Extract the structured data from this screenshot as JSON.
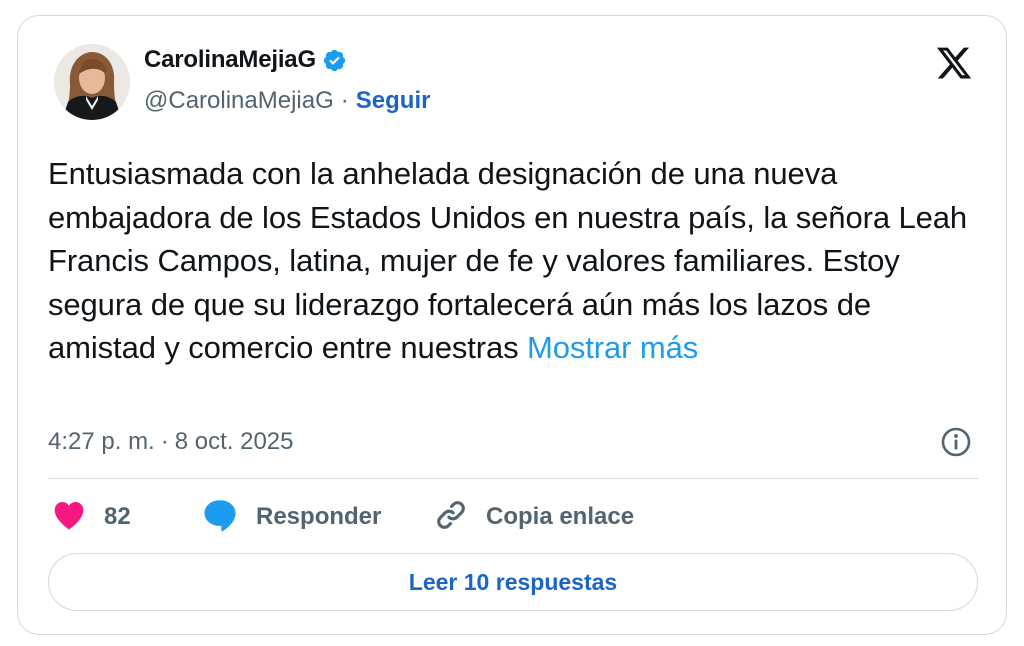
{
  "author": {
    "display_name": "CarolinaMejiaG",
    "handle": "@CarolinaMejiaG",
    "separator": "·",
    "follow_label": "Seguir",
    "verified": true
  },
  "tweet": {
    "text": "Entusiasmada con la anhelada designación de una nueva embajadora de los Estados Unidos en nuestra país, la señora Leah Francis Campos, latina, mujer de fe y valores familiares. Estoy segura de que su liderazgo fortalecerá aún más los lazos de amistad y comercio entre nuestras",
    "show_more_label": "Mostrar más",
    "time": "4:27 p. m.",
    "separator": "·",
    "date": "8 oct. 2025"
  },
  "actions": {
    "likes_count": "82",
    "reply_label": "Responder",
    "copy_link_label": "Copia enlace"
  },
  "read_replies_label": "Leer 10 respuestas",
  "icons": {
    "platform": "x-logo-icon",
    "verified": "verified-badge-icon",
    "info": "info-icon",
    "like": "heart-icon",
    "reply": "speech-bubble-icon",
    "copy": "link-icon"
  },
  "colors": {
    "link_blue": "#1d64c7",
    "show_more_blue": "#1d9bf0",
    "like_pink": "#f91880",
    "reply_blue": "#1d9bf0",
    "muted_text": "#536471"
  }
}
